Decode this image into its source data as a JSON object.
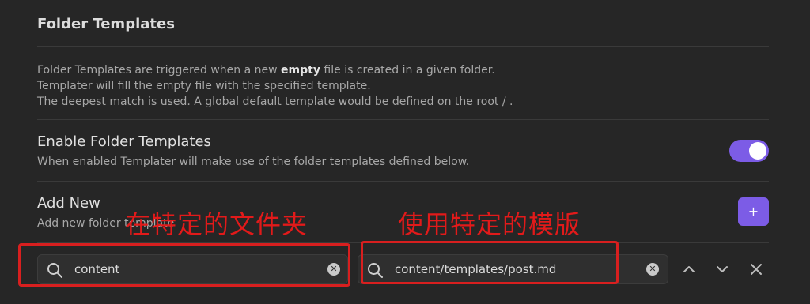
{
  "section": {
    "title": "Folder Templates"
  },
  "description": {
    "line1_prefix": "Folder Templates are triggered when a new ",
    "line1_bold": "empty",
    "line1_suffix": " file is created in a given folder.",
    "line2": "Templater will fill the empty file with the specified template.",
    "line3": "The deepest match is used. A global default template would be defined on the root  / ."
  },
  "enable_setting": {
    "name": "Enable Folder Templates",
    "desc": "When enabled Templater will make use of the folder templates defined below.",
    "enabled": true
  },
  "add_setting": {
    "name": "Add New",
    "desc": "Add new folder template",
    "button_label": "+"
  },
  "folder_row": {
    "folder_value": "content",
    "template_value": "content/templates/post.md"
  },
  "annotations": {
    "folder_label": "在特定的文件夹",
    "template_label": "使用特定的模版"
  },
  "colors": {
    "accent": "#7c5ce6",
    "annotation": "#e21a1a",
    "background": "#262626"
  },
  "icons": [
    "search-icon",
    "clear-icon",
    "arrow-up-icon",
    "arrow-down-icon",
    "close-icon"
  ]
}
